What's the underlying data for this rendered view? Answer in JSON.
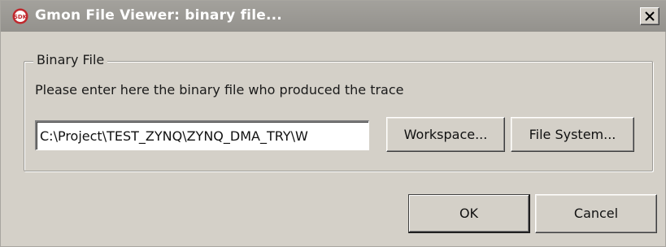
{
  "window": {
    "title": "Gmon File Viewer: binary file...",
    "app_icon": "sdk-logo-icon",
    "close_icon": "close-icon"
  },
  "group": {
    "legend": "Binary File",
    "instruction": "Please enter here the binary file who produced the trace"
  },
  "binary_path": {
    "value": "C:\\Project\\TEST_ZYNQ\\ZYNQ_DMA_TRY\\W"
  },
  "buttons": {
    "workspace_label": "Workspace...",
    "filesystem_label": "File System...",
    "ok_label": "OK",
    "cancel_label": "Cancel"
  },
  "colors": {
    "dialog_face": "#d4d0c8",
    "titlebar_inactive": "#9a9893",
    "title_text": "#ffffff",
    "icon_red": "#c0282d"
  }
}
